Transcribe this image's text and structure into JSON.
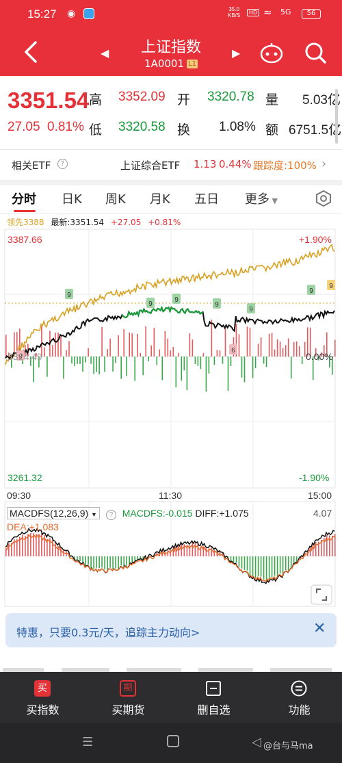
{
  "status_bar": {
    "time": "15:27",
    "net_speed_top": "35.0",
    "net_speed_unit": "KB/S",
    "hd": "HD",
    "signal": "5G",
    "battery": "56"
  },
  "header": {
    "title": "上证指数",
    "code": "1A0001",
    "level_badge": "L1"
  },
  "quote": {
    "price": "3351.54",
    "change": "27.05",
    "change_pct": "0.81%",
    "high_label": "高",
    "high": "3352.09",
    "low_label": "低",
    "low": "3320.58",
    "open_label": "开",
    "open": "3320.78",
    "turnover_label": "换",
    "turnover": "1.08%",
    "volume_label": "量",
    "volume": "5.03亿",
    "amount_label": "额",
    "amount": "6751.5亿"
  },
  "etf_row": {
    "label": "相关ETF",
    "etf_name": "上证综合ETF",
    "etf_price": "1.13",
    "etf_pct": "0.44%",
    "tracking": "跟踪度:100%"
  },
  "tabs": [
    {
      "label": "分时"
    },
    {
      "label": "日K"
    },
    {
      "label": "周K"
    },
    {
      "label": "月K"
    },
    {
      "label": "五日"
    },
    {
      "label": "更多"
    }
  ],
  "info_line": {
    "leader": "领先3388",
    "latest": "最新:3351.54",
    "change": "+27.05",
    "pct": "+0.81%"
  },
  "chart_labels": {
    "top_price": "3387.66",
    "top_pct": "+1.90%",
    "mid_price": "3324.49",
    "mid_pct": "0.00%",
    "bottom_price": "3261.32",
    "bottom_pct": "-1.90%",
    "t_start": "09:30",
    "t_mid": "11:30",
    "t_end": "15:00",
    "badges": [
      "9",
      "9",
      "9",
      "9",
      "9",
      "9",
      "9",
      "6",
      "9"
    ]
  },
  "macd": {
    "selector": "MACDFS(12,26,9)",
    "macdfs": "MACDFS:-0.015",
    "diff": "DIFF:+1.075",
    "dea": "DEA:+1.083",
    "max": "4.07"
  },
  "promo": {
    "text": "特惠，只要0.3元/天，追踪主力动向>"
  },
  "toolbar": [
    {
      "label": "买指数",
      "icon_char": "买"
    },
    {
      "label": "买期货",
      "icon_char": "期"
    },
    {
      "label": "删自选"
    },
    {
      "label": "功能"
    }
  ],
  "watermark": "@台与马ma",
  "colors": {
    "brand_red": "#e8303a",
    "up_red": "#e23237",
    "down_green": "#1a9a3a",
    "leader_orange": "#d8a020"
  }
}
